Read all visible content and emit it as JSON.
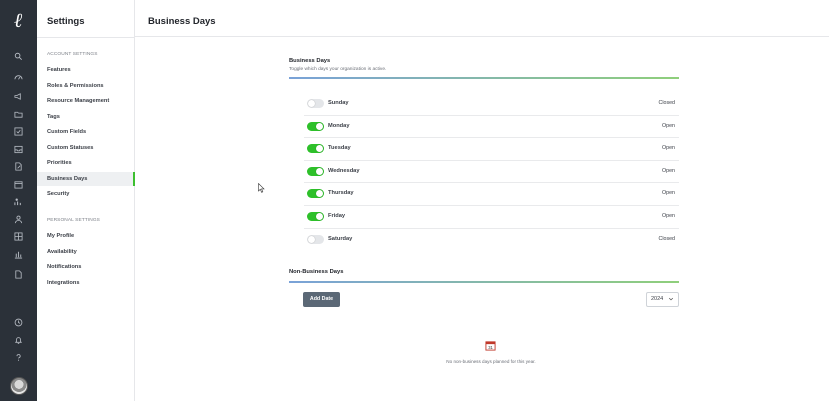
{
  "app": {
    "logo_glyph": "ℓ"
  },
  "rail": {
    "icons": [
      "search-icon",
      "dashboard-icon",
      "megaphone-icon",
      "folder-icon",
      "checklist-icon",
      "inbox-icon",
      "document-edit-icon",
      "calendar-icon",
      "people-chart-icon",
      "person-icon",
      "grid-icon",
      "bar-chart-icon",
      "document-icon",
      "clock-icon",
      "bell-icon",
      "help-icon"
    ]
  },
  "sidebar": {
    "title": "Settings",
    "account_section": "ACCOUNT SETTINGS",
    "account_items": [
      "Features",
      "Roles & Permissions",
      "Resource Management",
      "Tags",
      "Custom Fields",
      "Custom Statuses",
      "Priorities",
      "Business Days",
      "Security"
    ],
    "personal_section": "PERSONAL SETTINGS",
    "personal_items": [
      "My Profile",
      "Availability",
      "Notifications",
      "Integrations"
    ],
    "active_item": "Business Days"
  },
  "header": {
    "title": "Business Days"
  },
  "business_days": {
    "heading": "Business Days",
    "subtitle": "Toggle which days your organization is active.",
    "days": [
      {
        "name": "Sunday",
        "enabled": false,
        "status": "Closed"
      },
      {
        "name": "Monday",
        "enabled": true,
        "status": "Open"
      },
      {
        "name": "Tuesday",
        "enabled": true,
        "status": "Open"
      },
      {
        "name": "Wednesday",
        "enabled": true,
        "status": "Open"
      },
      {
        "name": "Thursday",
        "enabled": true,
        "status": "Open"
      },
      {
        "name": "Friday",
        "enabled": true,
        "status": "Open"
      },
      {
        "name": "Saturday",
        "enabled": false,
        "status": "Closed"
      }
    ]
  },
  "non_business_days": {
    "heading": "Non-Business Days",
    "add_label": "Add Date",
    "year": "2024",
    "calendar_glyph": "31",
    "empty_message": "No non-business days planned for this year."
  },
  "colors": {
    "toggle_on": "#2ec02a",
    "rail_bg": "#2b3139",
    "button_bg": "#5b6876"
  }
}
